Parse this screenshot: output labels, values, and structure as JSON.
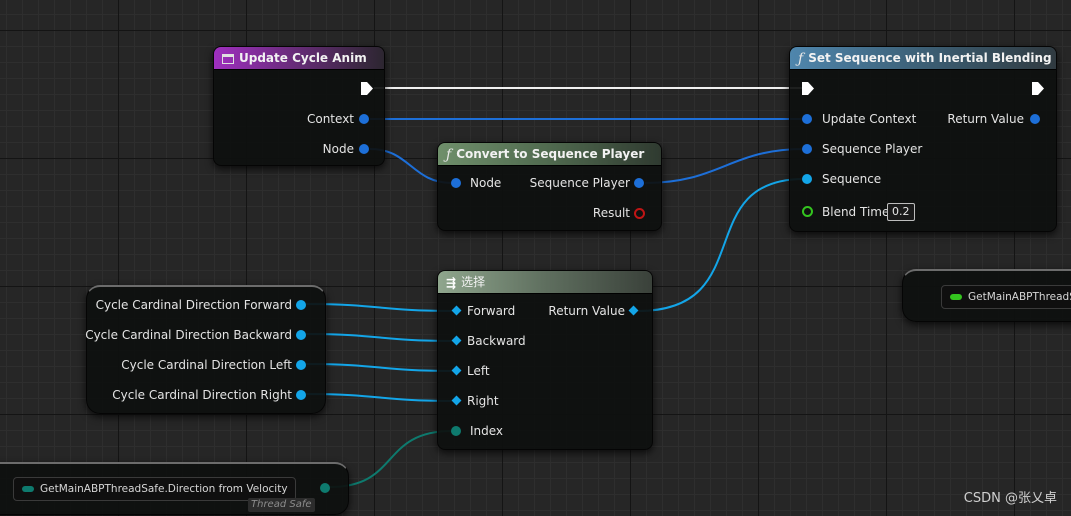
{
  "nodes": {
    "update_cycle_anim": {
      "title": "Update Cycle Anim",
      "pins_out": {
        "context": "Context",
        "node": "Node"
      }
    },
    "set_sequence": {
      "title": "Set Sequence with Inertial Blending",
      "pins_in": {
        "update_context": "Update Context",
        "sequence_player": "Sequence Player",
        "sequence": "Sequence",
        "blend_time": "Blend Time"
      },
      "blend_time_value": "0.2",
      "pins_out": {
        "return_value": "Return Value"
      }
    },
    "convert_to_sequence_player": {
      "title": "Convert to Sequence Player",
      "pins_in": {
        "node": "Node"
      },
      "pins_out": {
        "sequence_player": "Sequence Player",
        "result": "Result"
      }
    },
    "select": {
      "title": "选择",
      "pins_in": {
        "forward": "Forward",
        "backward": "Backward",
        "left": "Left",
        "right": "Right",
        "index": "Index"
      },
      "pins_out": {
        "return_value": "Return Value"
      }
    },
    "cycle_vars": {
      "forward": "Cycle Cardinal Direction Forward",
      "backward": "Cycle Cardinal Direction Backward",
      "left": "Cycle Cardinal Direction Left",
      "right": "Cycle Cardinal Direction Right"
    },
    "getter_velocity": {
      "label": "GetMainABPThreadSafe.Direction from Velocity",
      "badge": "Thread Safe"
    },
    "getter_right": {
      "label": "GetMainABPThreadSafe"
    }
  },
  "watermark": "CSDN @张乂卓",
  "colors": {
    "object_pin": "#1d6fd8",
    "anim_pin": "#13a5e8",
    "float_pin": "#34c41f",
    "enum_pin": "#0e7a6e",
    "bool_pin": "#c01515",
    "exec_pin": "#ffffff"
  },
  "icons": {
    "event_icon": "square-window-icon",
    "function_icon": "function-f-icon",
    "select_icon": "select-icon",
    "dropdown_icon": "chevron-down-icon"
  }
}
